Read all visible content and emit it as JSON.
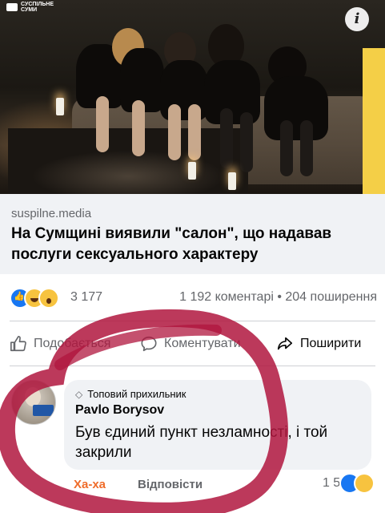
{
  "image": {
    "logo_text": "СУСПІЛЬНЕ СУМИ",
    "info_icon": "info-icon"
  },
  "preview": {
    "domain": "suspilne.media",
    "headline": "На Сумщині виявили \"салон\", що надавав послуги сексуального характеру"
  },
  "stats": {
    "reactions": [
      "like-reaction",
      "haha-reaction",
      "wow-reaction"
    ],
    "reaction_count": "3 177",
    "comments_shares": "1 192 коментарі • 204 поширення"
  },
  "actions": {
    "like_label": "Подобається",
    "comment_label": "Коментувати",
    "share_label": "Поширити"
  },
  "comment": {
    "badge": "Топовий прихильник",
    "author": "Pavlo Borysov",
    "text": "Був єдиний пункт незламності, і той закрили",
    "haha_label": "Ха-ха",
    "reply_label": "Відповісти",
    "reaction_count": "1 586",
    "reactions": [
      "like-reaction",
      "haha-reaction"
    ]
  },
  "colors": {
    "accent": "#1877f2",
    "marker": "#b0163e",
    "preview_bg": "#f0f2f5",
    "edge_yellow": "#f4cf47"
  }
}
